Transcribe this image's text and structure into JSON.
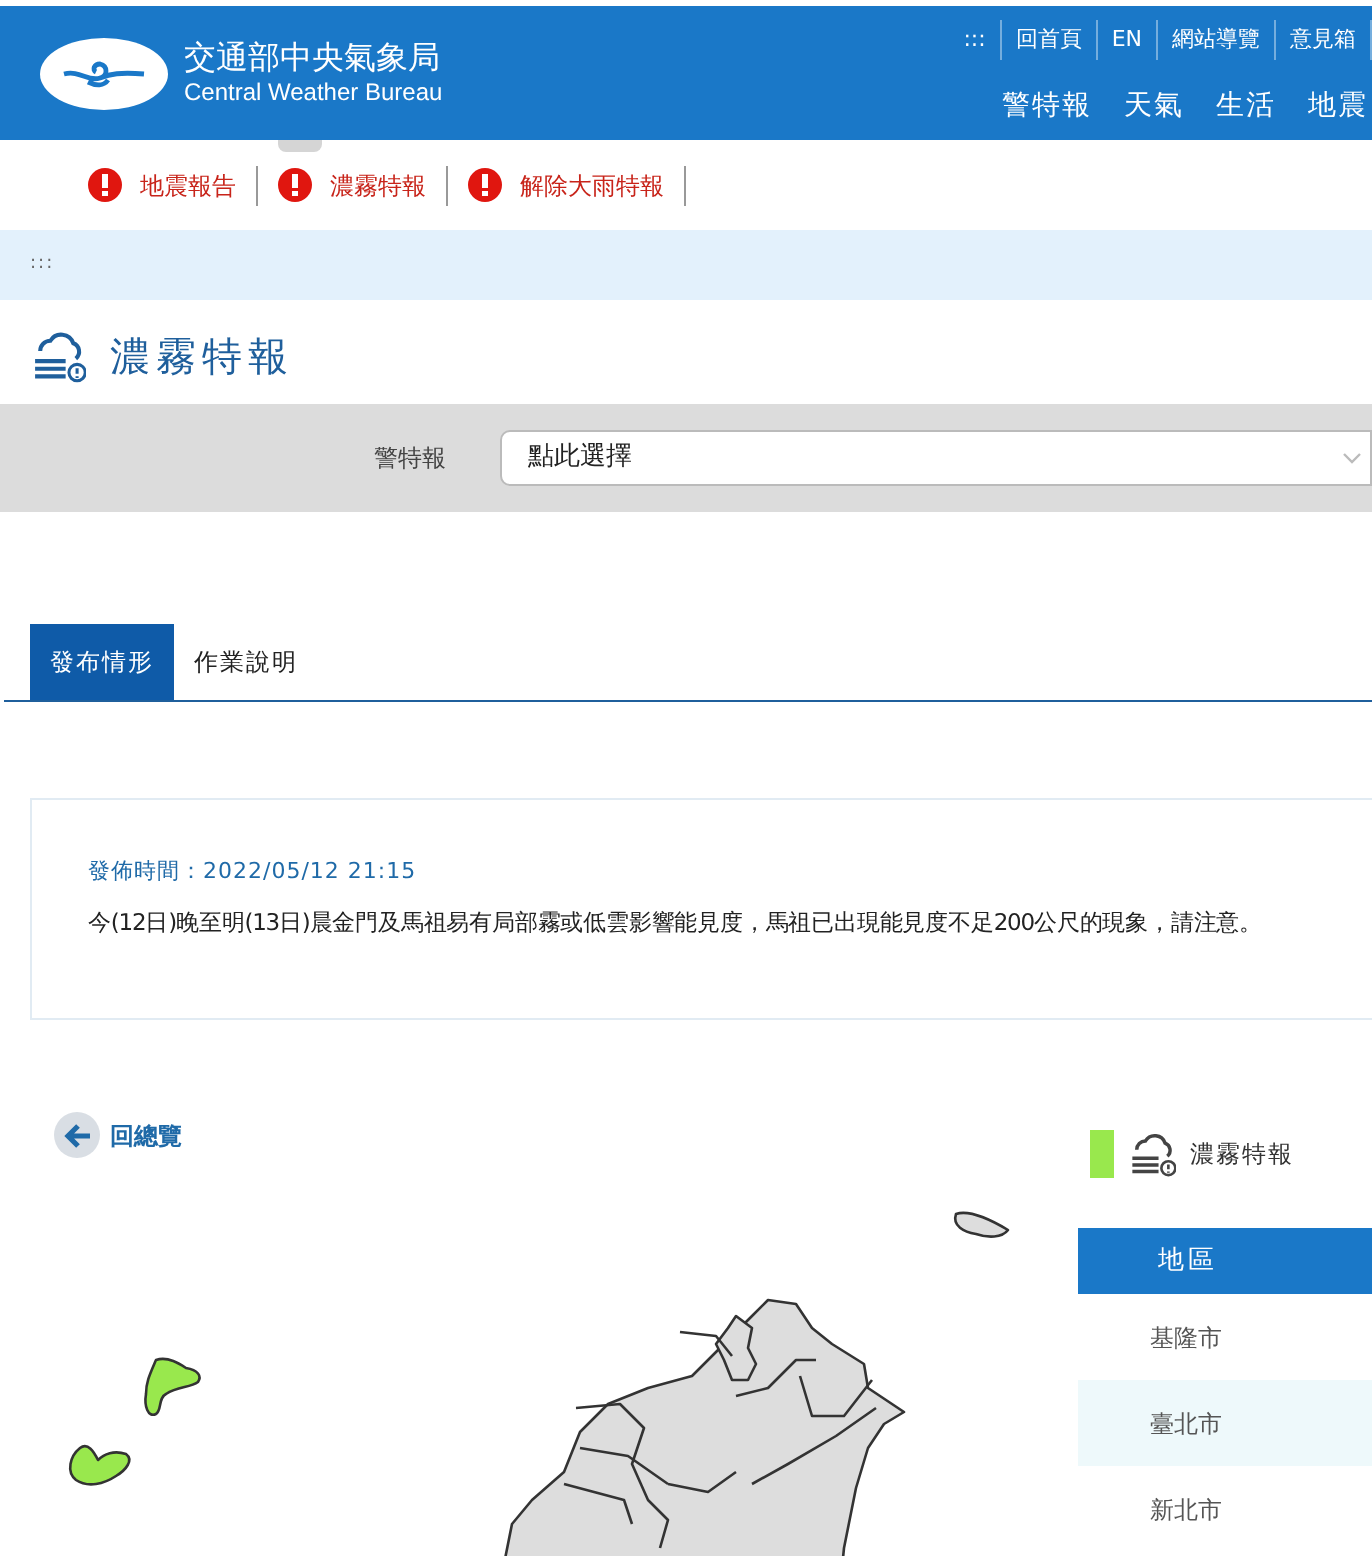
{
  "header": {
    "org_name": "交通部中央氣象局",
    "org_name_en": "Central Weather Bureau",
    "top_links": [
      ":::",
      "回首頁",
      "EN",
      "網站導覽",
      "意見箱"
    ],
    "nav": [
      "警特報",
      "天氣",
      "生活",
      "地震"
    ]
  },
  "alerts": [
    {
      "label": "地震報告"
    },
    {
      "label": "濃霧特報"
    },
    {
      "label": "解除大雨特報"
    }
  ],
  "breadcrumb": ":::",
  "page_title": "濃霧特報",
  "filter": {
    "label": "警特報",
    "select_value": "點此選擇"
  },
  "tabs": [
    {
      "label": "發布情形",
      "selected": true
    },
    {
      "label": "作業說明",
      "selected": false
    }
  ],
  "notice": {
    "time_label": "發佈時間：2022/05/12 21:15",
    "text": "今(12日)晚至明(13日)晨金門及馬祖易有局部霧或低雲影響能見度，馬祖已出現能見度不足200公尺的現象，請注意。"
  },
  "back_link": "回總覽",
  "legend": {
    "color": "#99e84d",
    "label": "濃霧特報"
  },
  "region_table": {
    "header": "地區",
    "rows": [
      {
        "name": "基隆市"
      },
      {
        "name": "臺北市"
      },
      {
        "name": "新北市"
      }
    ]
  }
}
